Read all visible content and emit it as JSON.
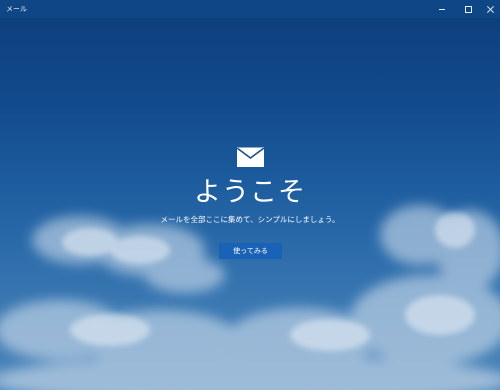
{
  "window": {
    "title": "メール",
    "controls": {
      "minimize": "minimize-icon",
      "maximize": "maximize-icon",
      "close": "close-icon"
    }
  },
  "welcome": {
    "icon": "mail-envelope-icon",
    "heading": "ようこそ",
    "subtitle": "メールを全部ここに集めて、シンプルにしましょう。",
    "button_label": "使ってみる"
  },
  "colors": {
    "titlebar": "#0f4786",
    "button": "#1a62b5",
    "sky_top": "#0d3d7a",
    "sky_bottom": "#4d86ba"
  }
}
